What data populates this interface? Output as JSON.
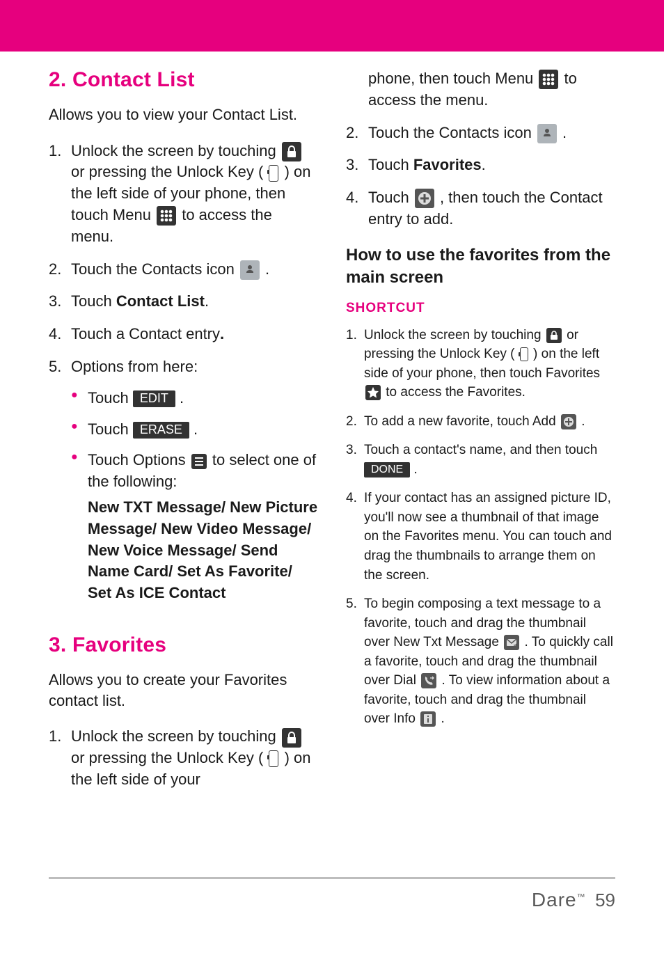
{
  "sections": {
    "contact_list": {
      "title": "2. Contact List",
      "intro": "Allows you to view your Contact List.",
      "steps": {
        "s1_num": "1.",
        "s1a": "Unlock the screen by touching ",
        "s1b": " or pressing the Unlock Key ( ",
        "s1c": " ) on the left side of your phone, then touch Menu ",
        "s1d": " to access the menu.",
        "s2_num": "2.",
        "s2a": "Touch the Contacts icon ",
        "s2b": " .",
        "s3_num": "3.",
        "s3a": "Touch ",
        "s3b": "Contact List",
        "s3c": ".",
        "s4_num": "4.",
        "s4a": "Touch a Contact entry",
        "s4b": ".",
        "s5_num": "5.",
        "s5a": "Options from here:",
        "opt1a": "Touch ",
        "opt1_pill": "EDIT",
        "opt1b": " .",
        "opt2a": "Touch ",
        "opt2_pill": "ERASE",
        "opt2b": " .",
        "opt3a": "Touch Options ",
        "opt3b": " to select one of the following:",
        "opt3_bold": "New TXT Message/ New Picture Message/ New Video Message/ New Voice Message/ Send Name Card/ Set As Favorite/ Set As ICE Contact"
      }
    },
    "favorites": {
      "title": "3. Favorites",
      "intro": "Allows you to create your Favorites contact list.",
      "steps": {
        "s1_num": "1.",
        "s1a": "Unlock the screen by touching ",
        "s1b": " or pressing the Unlock Key ( ",
        "s1c": " ) on the left side of your ",
        "s1d_cont": "phone, then touch Menu ",
        "s1e_cont": " to access the menu.",
        "s2_num": "2.",
        "s2a": "Touch the Contacts icon ",
        "s2b": " .",
        "s3_num": "3.",
        "s3a": "Touch ",
        "s3b": "Favorites",
        "s3c": ".",
        "s4_num": "4.",
        "s4a": "Touch ",
        "s4b": " , then touch the Contact entry to add."
      },
      "subheading": "How to use the favorites from the main screen",
      "shortcut_label": "SHORTCUT",
      "shortcut": {
        "s1_num": "1.",
        "s1a": "Unlock the screen by touching ",
        "s1b": " or pressing the Unlock Key ( ",
        "s1c": " ) on the left side of your phone, then touch Favorites ",
        "s1d": " to access the Favorites.",
        "s2_num": "2.",
        "s2a": "To add a new favorite, touch Add ",
        "s2b": " .",
        "s3_num": "3.",
        "s3a": "Touch a contact's name, and then touch ",
        "s3_pill": "DONE",
        "s3b": " .",
        "s4_num": "4.",
        "s4a": "If your contact has an assigned picture ID, you'll now see a thumbnail of that image on the Favorites menu. You can touch and drag the thumbnails to arrange them on the screen.",
        "s5_num": "5.",
        "s5a": "To begin composing a text message to a favorite, touch and drag the thumbnail over New Txt Message ",
        "s5b": ". To quickly call a favorite, touch and drag the thumbnail over Dial ",
        "s5c": " . To view information about a favorite, touch and drag the thumbnail over Info ",
        "s5d": " ."
      }
    }
  },
  "footer": {
    "brand": "Dare",
    "tm": "™",
    "page": "59"
  }
}
